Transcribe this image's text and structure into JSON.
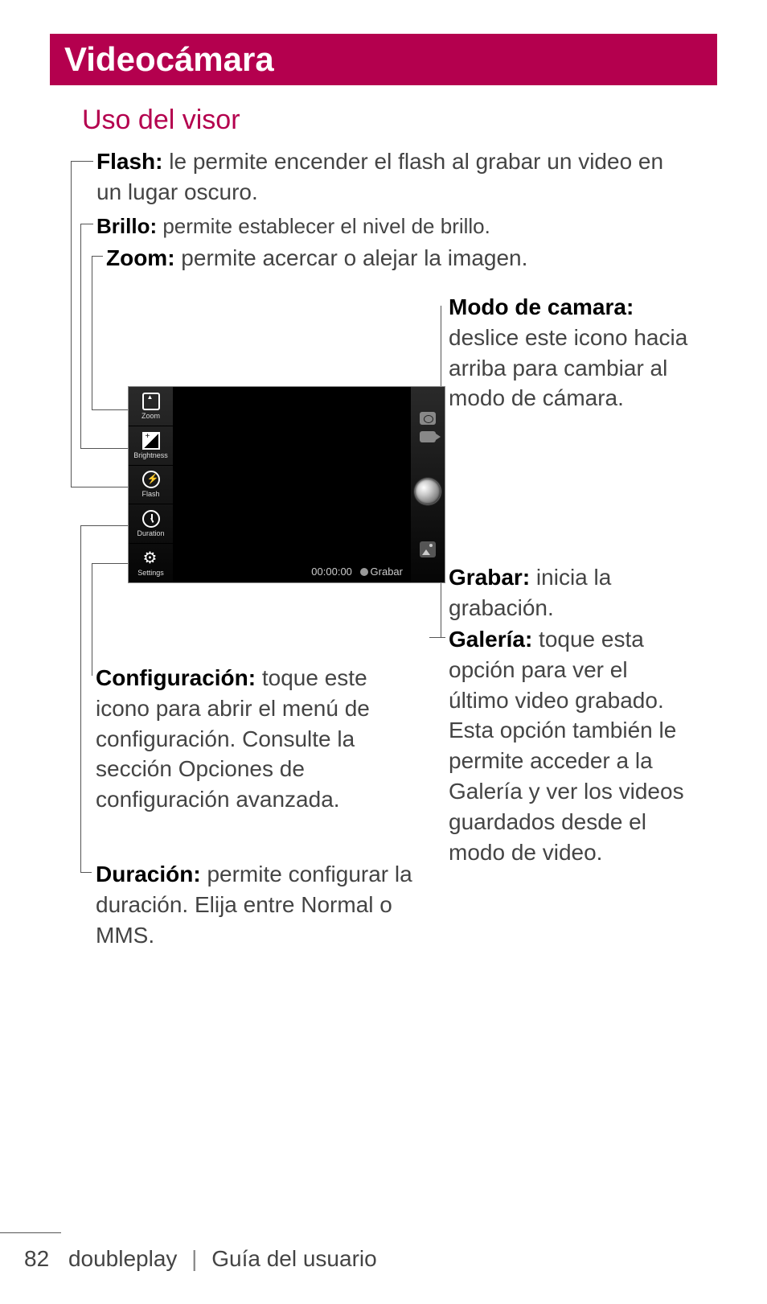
{
  "header": {
    "title": "Videocámara"
  },
  "section": {
    "title": "Uso del visor"
  },
  "callouts": {
    "flash": {
      "label": "Flash:",
      "desc": " le permite encender el flash al grabar un video en un lugar oscuro."
    },
    "brillo": {
      "label": "Brillo:",
      "desc": " permite establecer el nivel de brillo."
    },
    "zoom": {
      "label": "Zoom:",
      "desc": " permite acercar o alejar la imagen."
    },
    "modo": {
      "label": "Modo de camara:",
      "desc": " deslice este icono hacia arriba para cambiar al modo de cámara."
    },
    "grabar": {
      "label": "Grabar:",
      "desc": " inicia la grabación."
    },
    "galeria": {
      "label": "Galería:",
      "desc": " toque esta opción para ver el último video grabado. Esta opción también le permite acceder a la Galería y ver los videos guardados desde el modo de video."
    },
    "config": {
      "label": "Configuración:",
      "desc": " toque este icono para abrir el menú de configuración. Consulte la sección Opciones de configuración avanzada."
    },
    "duracion": {
      "label": "Duración:",
      "desc": " permite configurar la duración. Elija entre Normal o MMS."
    }
  },
  "viewfinder": {
    "sidebar": {
      "zoom": "Zoom",
      "brightness": "Brightness",
      "flash": "Flash",
      "duration": "Duration",
      "settings": "Settings"
    },
    "timer": "00:00:00",
    "record_label": "Grabar"
  },
  "footer": {
    "page_number": "82",
    "brand": "doubleplay",
    "sep": "|",
    "guide": "Guía del usuario"
  }
}
